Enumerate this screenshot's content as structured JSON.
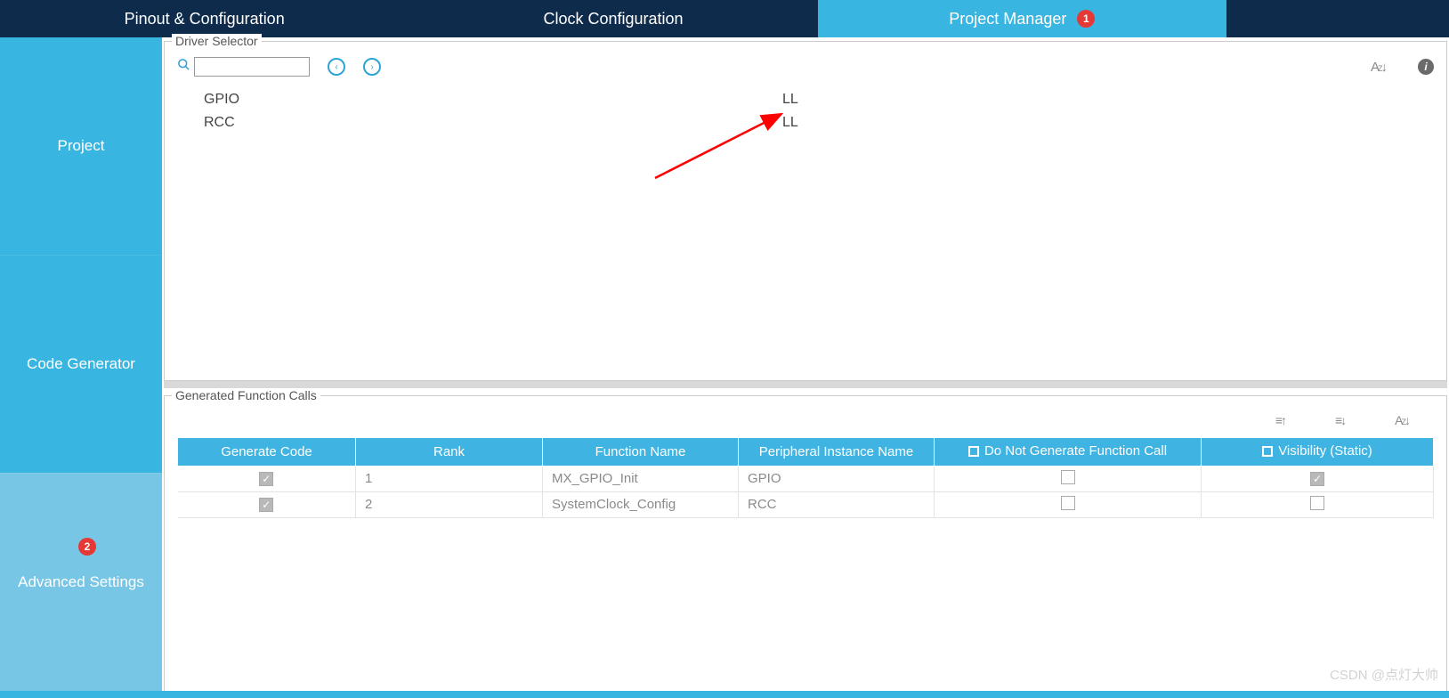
{
  "tabs": {
    "pinout": "Pinout & Configuration",
    "clock": "Clock Configuration",
    "project_manager": "Project Manager"
  },
  "sidebar": {
    "project": "Project",
    "codegen": "Code Generator",
    "advanced": "Advanced Settings"
  },
  "driver_selector": {
    "legend": "Driver Selector",
    "search_value": "",
    "rows": [
      {
        "name": "GPIO",
        "value": "LL"
      },
      {
        "name": "RCC",
        "value": "LL"
      }
    ]
  },
  "generated_calls": {
    "legend": "Generated Function Calls",
    "headers": {
      "generate_code": "Generate Code",
      "rank": "Rank",
      "function_name": "Function Name",
      "peripheral": "Peripheral Instance Name",
      "do_not_generate": "Do Not Generate Function Call",
      "visibility": "Visibility (Static)"
    },
    "rows": [
      {
        "gen": true,
        "rank": "1",
        "fn": "MX_GPIO_Init",
        "peri": "GPIO",
        "dng": false,
        "vis": true
      },
      {
        "gen": true,
        "rank": "2",
        "fn": "SystemClock_Config",
        "peri": "RCC",
        "dng": false,
        "vis": false
      }
    ]
  },
  "annotations": {
    "badge1": "1",
    "badge2": "2"
  },
  "watermark": "CSDN @点灯大帅"
}
